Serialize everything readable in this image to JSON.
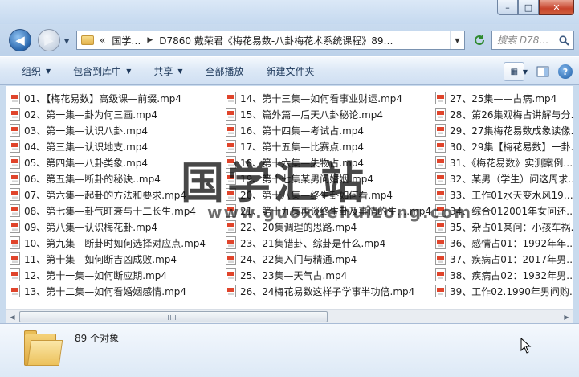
{
  "window": {
    "minimize_glyph": "–",
    "maximize_glyph": "□",
    "close_glyph": "✕"
  },
  "address": {
    "crumbs": [
      "«",
      "国学…",
      "D7860 戴荣君《梅花易数-八卦梅花术系统课程》89…"
    ],
    "search_placeholder": "搜索 D78…"
  },
  "toolbar": {
    "organize": "组织",
    "include_in_library": "包含到库中",
    "share": "共享",
    "play_all": "全部播放",
    "new_folder": "新建文件夹"
  },
  "files": {
    "column1": [
      "01、【梅花易数】高级课—前缀.mp4",
      "02、第一集—卦为何三画.mp4",
      "03、第一集—认识八卦.mp4",
      "04、第三集—认识地支.mp4",
      "05、第四集—八卦类象.mp4",
      "06、第五集—断卦的秘诀..mp4",
      "07、第六集—起卦的方法和要求.mp4",
      "08、第七集—卦气旺衰与十二长生.mp4",
      "09、第八集—认识梅花卦.mp4",
      "10、第九集—断卦时如何选择对应点.mp4",
      "11、第十集—如何断吉凶成败.mp4",
      "12、第十一集—如何断应期.mp4",
      "13、第十二集—如何看婚姻感情.mp4"
    ],
    "column2": [
      "14、第十三集—如何看事业财运.mp4",
      "15、篇外篇—后天八卦秘论.mp4",
      "16、第十四集—考试占.mp4",
      "17、第十五集—比赛点.mp4",
      "18、第十六集—失物占.mp4",
      "19、第十七集某男问婚姻.mp4",
      "20、第十八集—终生卦如何看.mp4",
      "21、第十九集再谈终生卦及事情的生….mp4",
      "22、20集调理的思路.mp4",
      "23、21集错卦、综卦是什么.mp4",
      "24、22集入门与精通.mp4",
      "25、23集—天气占.mp4",
      "26、24梅花易数这样子学事半功倍.mp4"
    ],
    "column3": [
      "27、25集——占病.mp4",
      "28、第26集观梅占讲解与分…",
      "29、27集梅花易数成象读像…",
      "30、29集【梅花易数】一卦…",
      "31、《梅花易数》实测案例…",
      "32、某男（学生）问这周求…",
      "33、工作01水天变水风19…",
      "34、综合012001年女问还…",
      "35、杂占01某问：小孩车祸…",
      "36、感情占01：1992年年…",
      "37、疾病占01：2017年男…",
      "38、疾病占02：1932年男…",
      "39、工作02.1990年男问购…"
    ]
  },
  "watermark": {
    "title": "国学汇站",
    "url": "www.guoxuehuizong.com"
  },
  "details": {
    "count": "89 个对象"
  },
  "colors": {
    "mp4_icon_red": "#e0442b",
    "toolbar_text": "#1e395b",
    "close_button": "#c7432b"
  }
}
